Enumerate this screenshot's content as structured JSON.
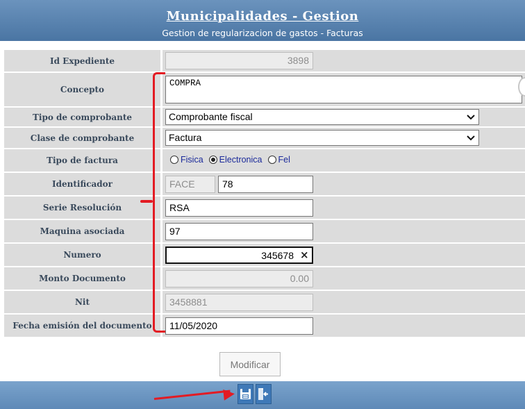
{
  "header": {
    "title": "Municipalidades - Gestion",
    "subtitle": "Gestion de regularizacion de gastos - Facturas"
  },
  "form": {
    "id_expediente": {
      "label": "Id Expediente",
      "value": "3898"
    },
    "concepto": {
      "label": "Concepto",
      "value": "COMPRA"
    },
    "tipo_comprobante": {
      "label": "Tipo de comprobante",
      "selected": "Comprobante fiscal"
    },
    "clase_comprobante": {
      "label": "Clase de comprobante",
      "selected": "Factura"
    },
    "tipo_factura": {
      "label": "Tipo de factura",
      "options": [
        "Fisica",
        "Electronica",
        "Fel"
      ],
      "selected": "Electronica"
    },
    "identificador": {
      "label": "Identificador",
      "prefix": "FACE",
      "value": "78"
    },
    "serie_resolucion": {
      "label": "Serie Resolución",
      "value": "RSA"
    },
    "maquina_asociada": {
      "label": "Maquina asociada",
      "value": "97"
    },
    "numero": {
      "label": "Numero",
      "value": "345678",
      "clear": "×"
    },
    "monto_documento": {
      "label": "Monto Documento",
      "value": "0.00"
    },
    "nit": {
      "label": "Nit",
      "value": "3458881"
    },
    "fecha_emision": {
      "label": "Fecha emisión del documento",
      "value": "11/05/2020"
    }
  },
  "actions": {
    "modify_label": "Modificar"
  },
  "toolbar": {
    "icons": [
      "save-icon",
      "exit-icon"
    ]
  },
  "colors": {
    "header": "#4a75a3",
    "annotation": "#e31b23",
    "label_bg": "#dcdcdc"
  }
}
